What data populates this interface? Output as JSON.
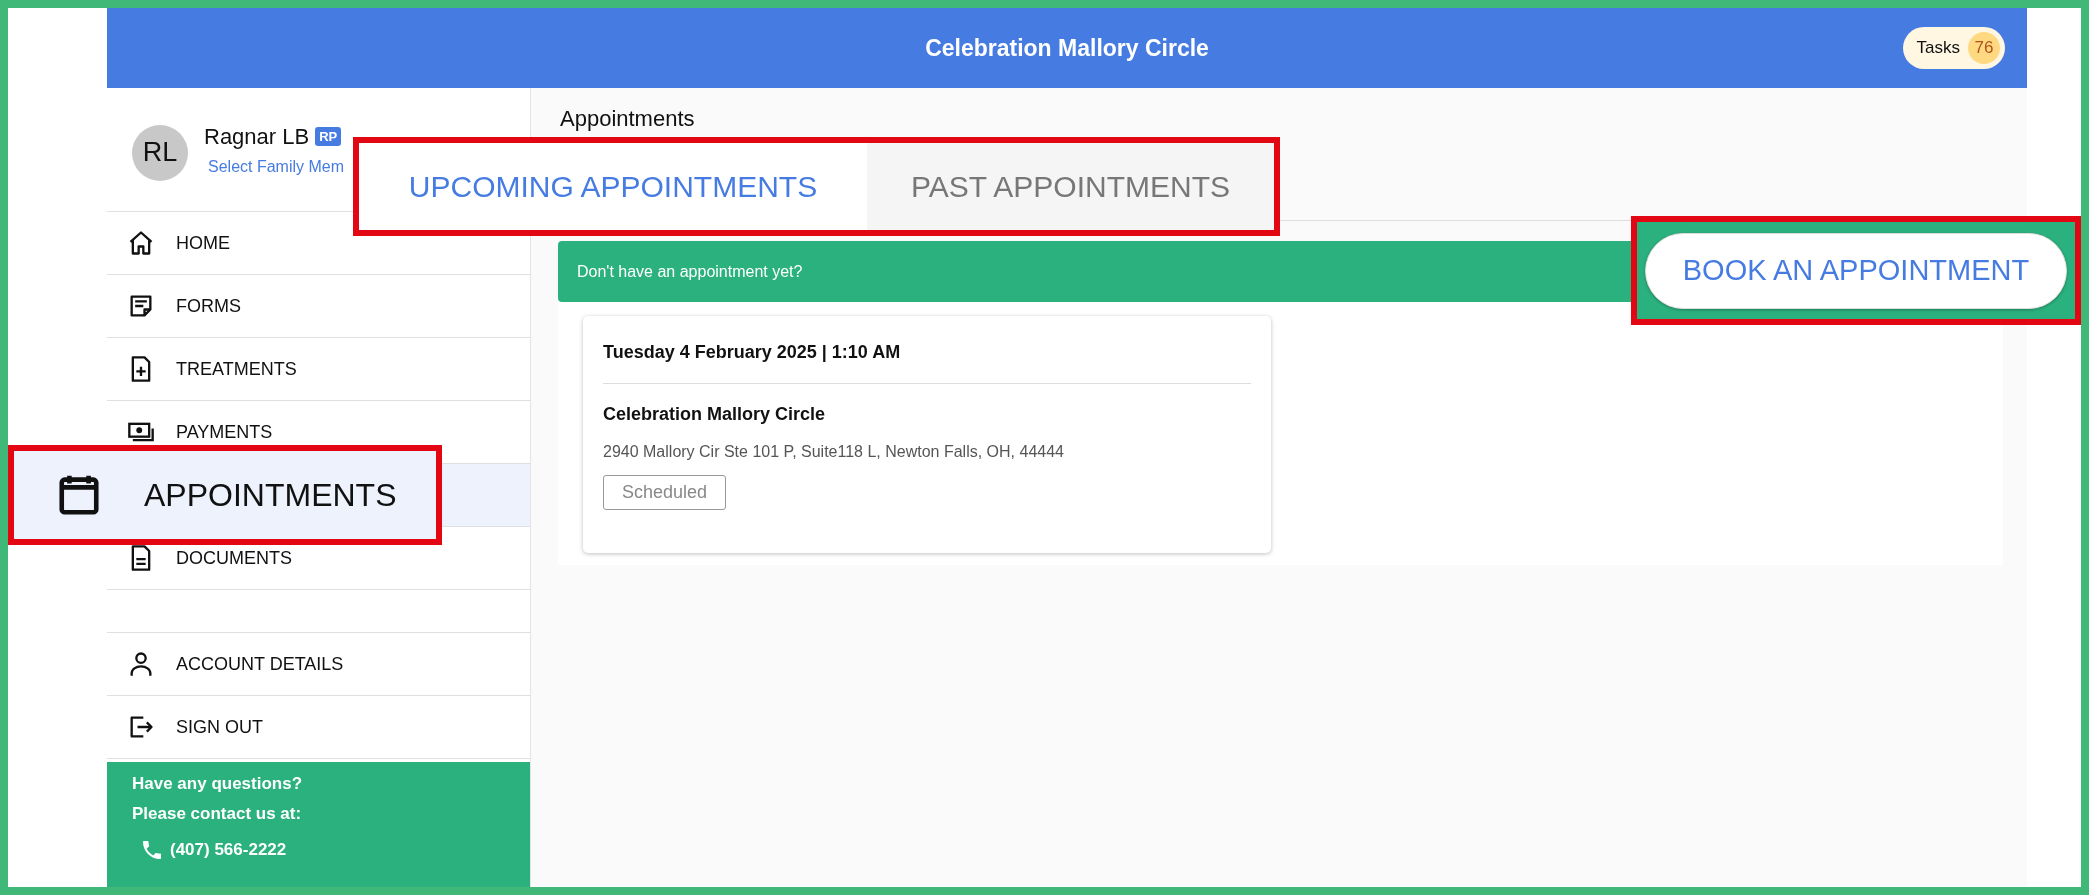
{
  "header": {
    "title": "Celebration Mallory Circle",
    "tasks": {
      "label": "Tasks",
      "count": "76"
    }
  },
  "profile": {
    "initials": "RL",
    "name": "Ragnar LB",
    "badge": "RP",
    "link": "Select Family Mem"
  },
  "nav": [
    {
      "kind": "home",
      "label": "HOME",
      "selected": false
    },
    {
      "kind": "form",
      "label": "FORMS",
      "selected": false
    },
    {
      "kind": "treatment",
      "label": "TREATMENTS",
      "selected": false
    },
    {
      "kind": "payment",
      "label": "PAYMENTS",
      "selected": false
    },
    {
      "kind": "calendar",
      "label": "APPOINTMENTS",
      "selected": true
    },
    {
      "kind": "document",
      "label": "DOCUMENTS",
      "selected": false
    }
  ],
  "account_nav": [
    {
      "kind": "person",
      "label": "ACCOUNT DETAILS"
    },
    {
      "kind": "signout",
      "label": "SIGN OUT"
    }
  ],
  "contact": {
    "lines": [
      "Have any questions?",
      "Please contact us at:"
    ],
    "phone": "(407) 566-2222"
  },
  "main": {
    "title": "Appointments",
    "tabs": [
      {
        "label": "UPCOMING APPOINTMENTS",
        "selected": true
      },
      {
        "label": "PAST APPOINTMENTS",
        "selected": false
      }
    ],
    "banner": {
      "text": "Don't have an appointment yet?",
      "button": "BOOK AN APPOINTMENT"
    },
    "appointments": [
      {
        "datetime": "Tuesday 4 February 2025 | 1:10 AM",
        "location": "Celebration Mallory Circle",
        "address": "2940 Mallory Cir Ste 101 P, Suite118 L, Newton Falls, OH, 44444",
        "status": "Scheduled"
      }
    ]
  }
}
